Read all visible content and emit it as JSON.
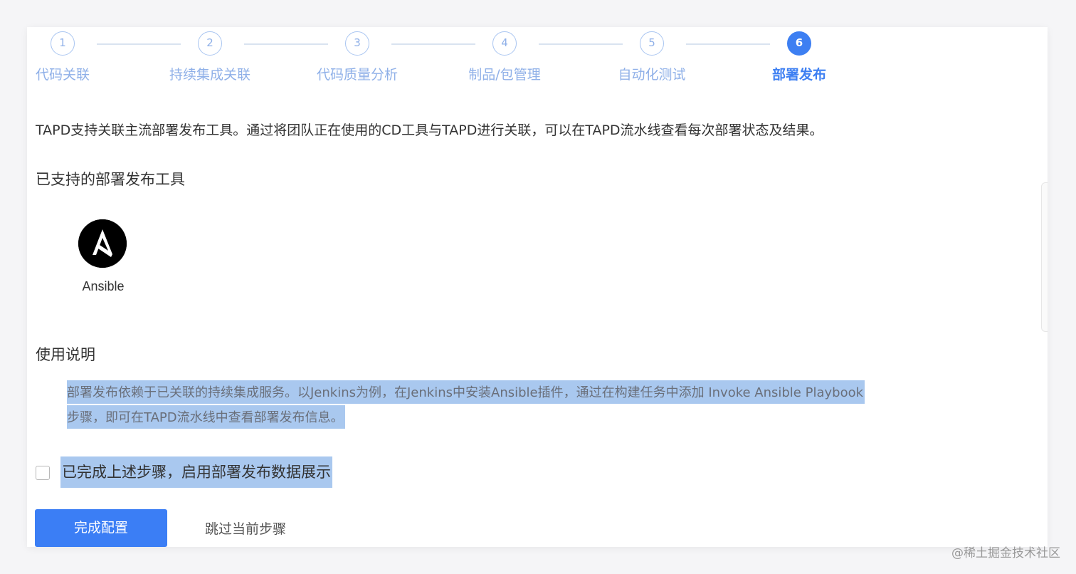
{
  "stepper": {
    "steps": [
      {
        "number": "1",
        "label": "代码关联"
      },
      {
        "number": "2",
        "label": "持续集成关联"
      },
      {
        "number": "3",
        "label": "代码质量分析"
      },
      {
        "number": "4",
        "label": "制品/包管理"
      },
      {
        "number": "5",
        "label": "自动化测试"
      },
      {
        "number": "6",
        "label": "部署发布"
      }
    ],
    "active_step": 6,
    "colors": {
      "active": "#3d7ff2",
      "inactive": "#8fb0e8",
      "line": "#d9e3f0"
    }
  },
  "intro_text": "TAPD支持关联主流部署发布工具。通过将团队正在使用的CD工具与TAPD进行关联，可以在TAPD流水线查看每次部署状态及结果。",
  "supported_tools": {
    "title": "已支持的部署发布工具",
    "items": [
      {
        "name": "Ansible",
        "icon": "ansible-logo-icon"
      }
    ]
  },
  "usage": {
    "title": "使用说明",
    "line1": "部署发布依赖于已关联的持续集成服务。以Jenkins为例，在Jenkins中安装Ansible插件，通过在构建任务中添加 Invoke Ansible Playbook",
    "line2": "步骤，即可在TAPD流水线中查看部署发布信息。"
  },
  "confirm": {
    "label": "已完成上述步骤，启用部署发布数据展示",
    "checked": false
  },
  "actions": {
    "finish_label": "完成配置",
    "skip_label": "跳过当前步骤",
    "primary_color": "#3b7ef5"
  },
  "watermark": "@稀土掘金技术社区"
}
